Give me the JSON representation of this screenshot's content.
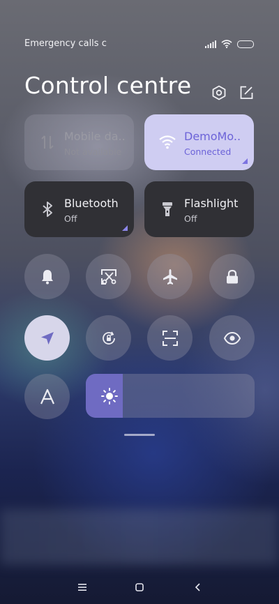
{
  "status": {
    "carrier_text": "Emergency calls c"
  },
  "header": {
    "title": "Control centre"
  },
  "tiles": [
    {
      "label": "Mobile da..",
      "sublabel": "Not available",
      "icon": "mobile-data-icon",
      "state": "disabled"
    },
    {
      "label": "DemoMo..",
      "sublabel": "Connected",
      "icon": "wifi-icon",
      "state": "active"
    },
    {
      "label": "Bluetooth",
      "sublabel": "Off",
      "icon": "bluetooth-icon",
      "state": "off"
    },
    {
      "label": "Flashlight",
      "sublabel": "Off",
      "icon": "flashlight-icon",
      "state": "off"
    }
  ],
  "toggles": [
    {
      "name": "bell-icon",
      "active": false
    },
    {
      "name": "screenshot-icon",
      "active": false
    },
    {
      "name": "airplane-icon",
      "active": false
    },
    {
      "name": "lock-icon",
      "active": false
    },
    {
      "name": "location-icon",
      "active": true
    },
    {
      "name": "auto-rotate-icon",
      "active": false
    },
    {
      "name": "scanner-icon",
      "active": false
    },
    {
      "name": "eye-icon",
      "active": false
    },
    {
      "name": "font-size-icon",
      "active": false
    }
  ],
  "brightness": {
    "level": 0.22
  },
  "colors": {
    "accent": "#6f6bc2",
    "active_tile_bg": "#cfcdf2",
    "active_text": "#6c63d8",
    "dark_tile_bg": "#303035"
  }
}
